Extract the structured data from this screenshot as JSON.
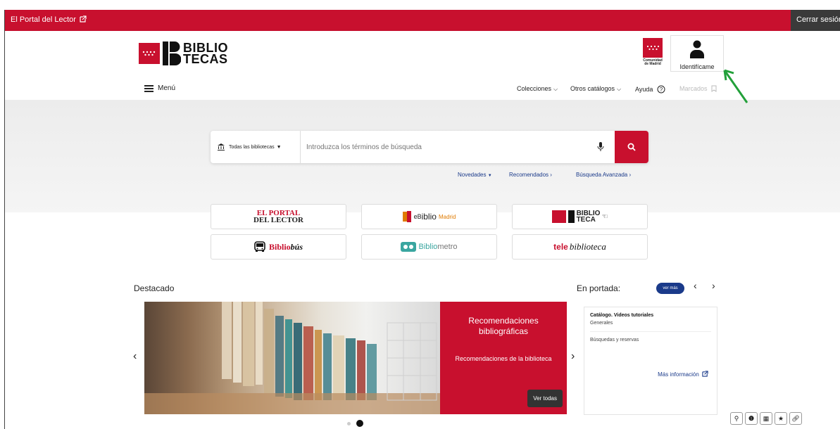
{
  "topbar": {
    "portal_link": "El Portal del Lector",
    "logout": "Cerrar sesión"
  },
  "logo": {
    "line1": "BIBLIO",
    "line2": "TECAS"
  },
  "community_logo": {
    "line1": "Comunidad",
    "line2": "de Madrid"
  },
  "identify_button": "Identifícame",
  "menu_label": "Menú",
  "nav": {
    "collections": "Colecciones",
    "other_catalogs": "Otros catálogos",
    "help": "Ayuda",
    "bookmarks": "Marcados"
  },
  "search": {
    "scope": "Todas las bibliotecas",
    "placeholder": "Introduzca los términos de búsqueda"
  },
  "sublinks": {
    "news": "Novedades",
    "recommended": "Recomendados",
    "advanced": "Búsqueda Avanzada"
  },
  "tiles": {
    "portal_l1": "EL PORTAL",
    "portal_l2": "DEL LECTOR",
    "eb_prefix": "eB",
    "eb_main": "iblio",
    "eb_madrid": "Madrid",
    "bt_line1": "BIBLIO",
    "bt_line2": "TECA",
    "bus_a": "Biblio",
    "bus_b": "bús",
    "metro_a": "Biblio",
    "metro_b": "metro",
    "tele_a": "tele",
    "tele_b": "biblioteca"
  },
  "featured": {
    "title": "Destacado",
    "panel_title": "Recomendaciones bibliográficas",
    "panel_sub": "Recomendaciones de la biblioteca",
    "see_all": "Ver todas"
  },
  "portada": {
    "title": "En portada:",
    "see_more": "ver más",
    "item1": "Catálogo. Videos tutoriales",
    "item1_tag": "Generales",
    "item2": "Búsquedas y reservas",
    "more_info": "Más información"
  },
  "colors": {
    "brand_red": "#c8102e",
    "link_blue": "#1a3a8a",
    "dark": "#3a3a3a",
    "annotation_green": "#22a03a"
  }
}
